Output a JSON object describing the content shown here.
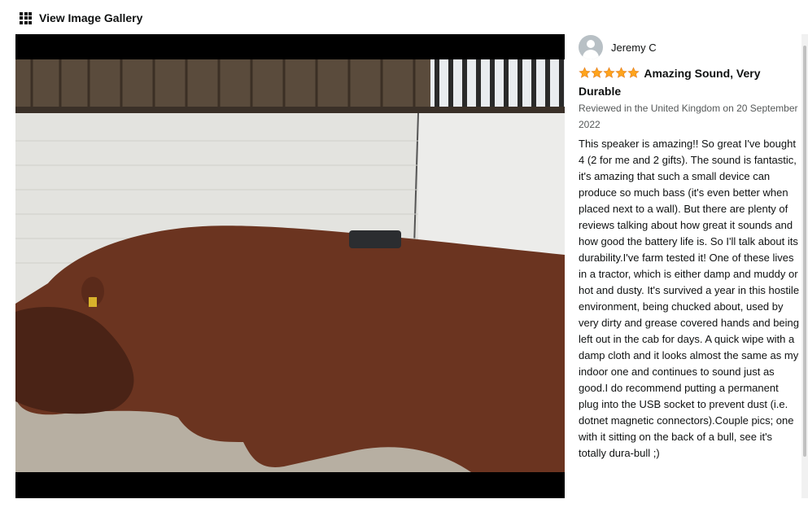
{
  "header": {
    "title": "View Image Gallery",
    "icon": "grid-icon"
  },
  "review": {
    "reviewer": "Jeremy C",
    "rating": 5,
    "rating_max": 5,
    "star_color": "#ffa41c",
    "title": "Amazing Sound, Very Durable",
    "meta": "Reviewed in the United Kingdom on 20 September 2022",
    "body": "This speaker is amazing!! So great I've bought 4 (2 for me and 2 gifts). The sound is fantastic, it's amazing that such a small device can produce so much bass (it's even better when placed next to a wall). But there are plenty of reviews talking about how great it sounds and how good the battery life is. So I'll talk about its durability.I've farm tested it! One of these lives in a tractor, which is either damp and muddy or hot and dusty. It's survived a year in this hostile environment, being chucked about, used by very dirty and grease covered hands and being left out in the cab for days. A quick wipe with a damp cloth and it looks almost the same as my indoor one and continues to sound just as good.I do recommend putting a permanent plug into the USB socket to prevent dust (i.e. dotnet magnetic connectors).Couple pics; one with it sitting on the back of a bull, see it's totally dura-bull ;)"
  }
}
